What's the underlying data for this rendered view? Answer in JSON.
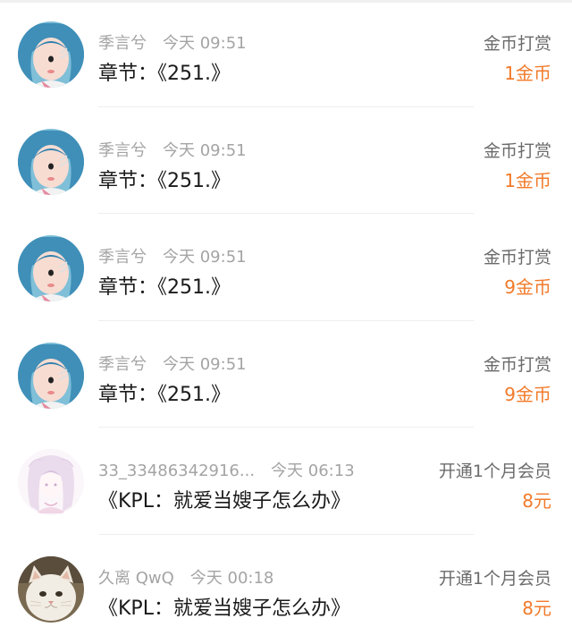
{
  "records": [
    {
      "user": "季言兮",
      "time": "今天 09:51",
      "title": "章节：《251.》",
      "type": "金币打赏",
      "amount": "1金币",
      "avatar": "cosplay-girl-blue-hair"
    },
    {
      "user": "季言兮",
      "time": "今天 09:51",
      "title": "章节：《251.》",
      "type": "金币打赏",
      "amount": "1金币",
      "avatar": "cosplay-girl-blue-hair"
    },
    {
      "user": "季言兮",
      "time": "今天 09:51",
      "title": "章节：《251.》",
      "type": "金币打赏",
      "amount": "9金币",
      "avatar": "cosplay-girl-blue-hair"
    },
    {
      "user": "季言兮",
      "time": "今天 09:51",
      "title": "章节：《251.》",
      "type": "金币打赏",
      "amount": "9金币",
      "avatar": "cosplay-girl-blue-hair"
    },
    {
      "user": "33_33486342916...",
      "time": "今天 06:13",
      "title": "《KPL：就爱当嫂子怎么办》",
      "type": "开通1个月会员",
      "amount": "8元",
      "avatar": "anime-sketch-girl"
    },
    {
      "user": "久离 QwQ",
      "time": "今天 00:18",
      "title": "《KPL：就爱当嫂子怎么办》",
      "type": "开通1个月会员",
      "amount": "8元",
      "avatar": "white-cat"
    }
  ],
  "colors": {
    "amount": "#f27a2a",
    "meta": "#a4a4a4",
    "title": "#1a1a1a",
    "kind": "#6b6b6b"
  }
}
